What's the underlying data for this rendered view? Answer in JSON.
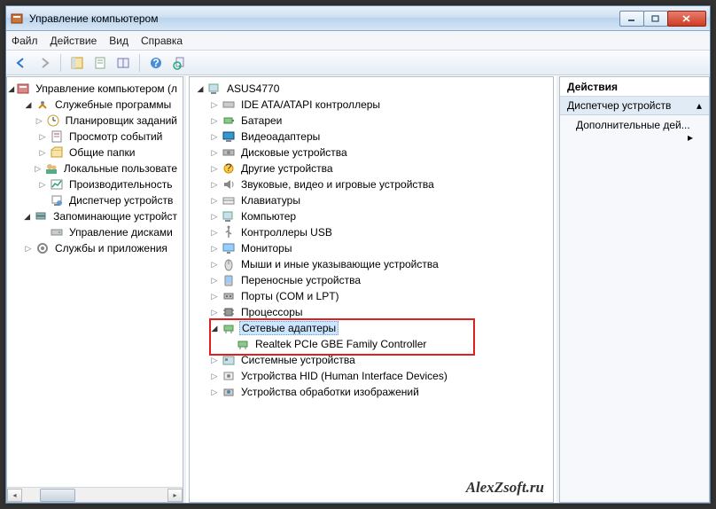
{
  "window": {
    "title": "Управление компьютером"
  },
  "menu": [
    "Файл",
    "Действие",
    "Вид",
    "Справка"
  ],
  "leftTree": [
    {
      "depth": 0,
      "exp": "open",
      "icon": "mmc",
      "label": "Управление компьютером (л"
    },
    {
      "depth": 1,
      "exp": "open",
      "icon": "tools",
      "label": "Служебные программы"
    },
    {
      "depth": 2,
      "exp": "closed",
      "icon": "sched",
      "label": "Планировщик заданий"
    },
    {
      "depth": 2,
      "exp": "closed",
      "icon": "event",
      "label": "Просмотр событий"
    },
    {
      "depth": 2,
      "exp": "closed",
      "icon": "share",
      "label": "Общие папки"
    },
    {
      "depth": 2,
      "exp": "closed",
      "icon": "users",
      "label": "Локальные пользовате"
    },
    {
      "depth": 2,
      "exp": "closed",
      "icon": "perf",
      "label": "Производительность"
    },
    {
      "depth": 2,
      "exp": "none",
      "icon": "devmgr",
      "label": "Диспетчер устройств"
    },
    {
      "depth": 1,
      "exp": "open",
      "icon": "storage",
      "label": "Запоминающие устройст"
    },
    {
      "depth": 2,
      "exp": "none",
      "icon": "disk",
      "label": "Управление дисками"
    },
    {
      "depth": 1,
      "exp": "closed",
      "icon": "services",
      "label": "Службы и приложения"
    }
  ],
  "centerTree": [
    {
      "depth": 0,
      "exp": "open",
      "icon": "computer",
      "label": "ASUS4770"
    },
    {
      "depth": 1,
      "exp": "closed",
      "icon": "ide",
      "label": "IDE ATA/ATAPI контроллеры"
    },
    {
      "depth": 1,
      "exp": "closed",
      "icon": "battery",
      "label": "Батареи"
    },
    {
      "depth": 1,
      "exp": "closed",
      "icon": "display",
      "label": "Видеоадаптеры"
    },
    {
      "depth": 1,
      "exp": "closed",
      "icon": "diskdrv",
      "label": "Дисковые устройства"
    },
    {
      "depth": 1,
      "exp": "closed",
      "icon": "other",
      "label": "Другие устройства"
    },
    {
      "depth": 1,
      "exp": "closed",
      "icon": "audio",
      "label": "Звуковые, видео и игровые устройства"
    },
    {
      "depth": 1,
      "exp": "closed",
      "icon": "keyboard",
      "label": "Клавиатуры"
    },
    {
      "depth": 1,
      "exp": "closed",
      "icon": "computer",
      "label": "Компьютер"
    },
    {
      "depth": 1,
      "exp": "closed",
      "icon": "usb",
      "label": "Контроллеры USB"
    },
    {
      "depth": 1,
      "exp": "closed",
      "icon": "monitor",
      "label": "Мониторы"
    },
    {
      "depth": 1,
      "exp": "closed",
      "icon": "mouse",
      "label": "Мыши и иные указывающие устройства"
    },
    {
      "depth": 1,
      "exp": "closed",
      "icon": "portable",
      "label": "Переносные устройства"
    },
    {
      "depth": 1,
      "exp": "closed",
      "icon": "port",
      "label": "Порты (COM и LPT)"
    },
    {
      "depth": 1,
      "exp": "closed",
      "icon": "cpu",
      "label": "Процессоры"
    },
    {
      "depth": 1,
      "exp": "open",
      "icon": "net",
      "label": "Сетевые адаптеры",
      "selected": true
    },
    {
      "depth": 2,
      "exp": "none",
      "icon": "net",
      "label": "Realtek PCIe GBE Family Controller",
      "highlighted": true
    },
    {
      "depth": 1,
      "exp": "closed",
      "icon": "system",
      "label": "Системные устройства"
    },
    {
      "depth": 1,
      "exp": "closed",
      "icon": "hid",
      "label": "Устройства HID (Human Interface Devices)"
    },
    {
      "depth": 1,
      "exp": "closed",
      "icon": "imaging",
      "label": "Устройства обработки изображений"
    }
  ],
  "actions": {
    "header": "Действия",
    "section": "Диспетчер устройств",
    "item": "Дополнительные дей..."
  },
  "watermark": "AlexZsoft.ru"
}
